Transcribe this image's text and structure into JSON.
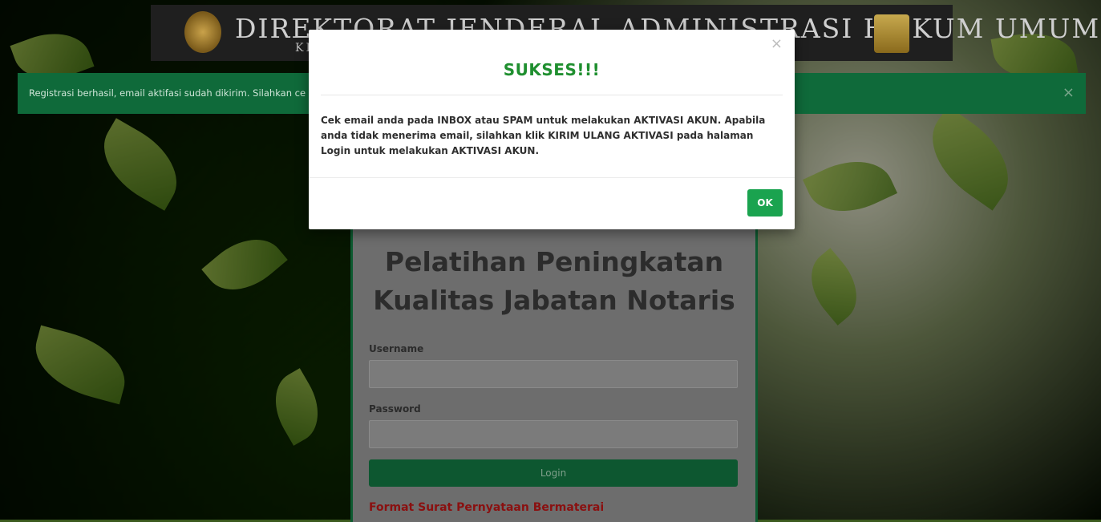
{
  "header": {
    "title": "DIREKTORAT JENDERAL ADMINISTRASI HUKUM UMUM",
    "subtitle": "KE"
  },
  "alert": {
    "text": "Registrasi berhasil, email aktifasi sudah dikirim. Silahkan ce",
    "close": "×"
  },
  "login": {
    "title_line1": "Pelatihan Peningkatan",
    "title_line2": "Kualitas Jabatan Notaris",
    "username_label": "Username",
    "password_label": "Password",
    "login_button": "Login",
    "format_link": "Format Surat Pernyataan Bermaterai"
  },
  "modal": {
    "close": "×",
    "title": "SUKSES!!!",
    "message": "Cek email anda pada INBOX atau SPAM untuk melakukan AKTIVASI AKUN. Apabila anda tidak menerima email, silahkan klik KIRIM ULANG AKTIVASI pada halaman Login untuk melakukan AKTIVASI AKUN.",
    "ok_button": "OK"
  },
  "colors": {
    "modal_title": "#1f8f2f",
    "ok_button": "#1aa34f",
    "alert_bg": "#0f6a3a",
    "login_button": "#0d5730",
    "format_link": "#8a1010"
  }
}
